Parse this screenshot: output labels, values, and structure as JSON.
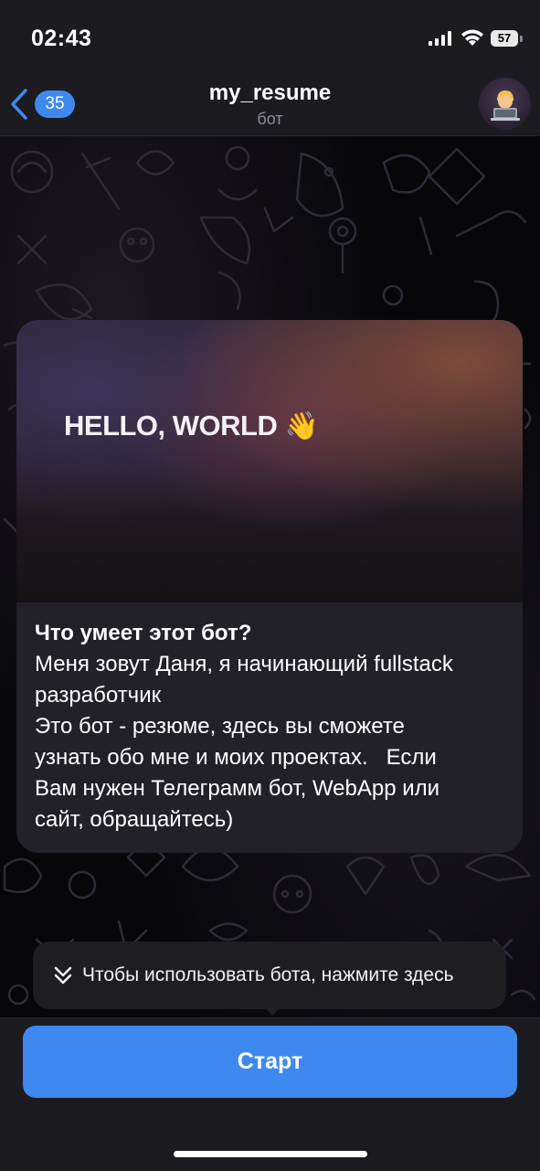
{
  "status_bar": {
    "time": "02:43",
    "battery": "57"
  },
  "header": {
    "back_badge": "35",
    "title": "my_resume",
    "subtitle": "бот"
  },
  "card": {
    "media_text": "HELLO, WORLD",
    "media_emoji": "👋",
    "heading": "Что умеет этот бот?",
    "lines": [
      "Меня зовут Даня, я начинающий fullstack",
      "разработчик",
      "Это бот - резюме, здесь вы сможете",
      "узнать обо мне и моих проектах.   Если",
      "Вам нужен Телеграмм бот, WebApp или",
      "сайт, обращайтесь)"
    ]
  },
  "hint": {
    "text": "Чтобы использовать бота, нажмите здесь"
  },
  "start_button": {
    "label": "Старт"
  },
  "colors": {
    "accent": "#3e89f0",
    "header_bg": "#1c1b20",
    "card_bg": "#232128"
  },
  "icons": [
    "back-chevron-icon",
    "signal-icon",
    "wifi-icon",
    "battery-icon",
    "chevron-down-double-icon"
  ]
}
